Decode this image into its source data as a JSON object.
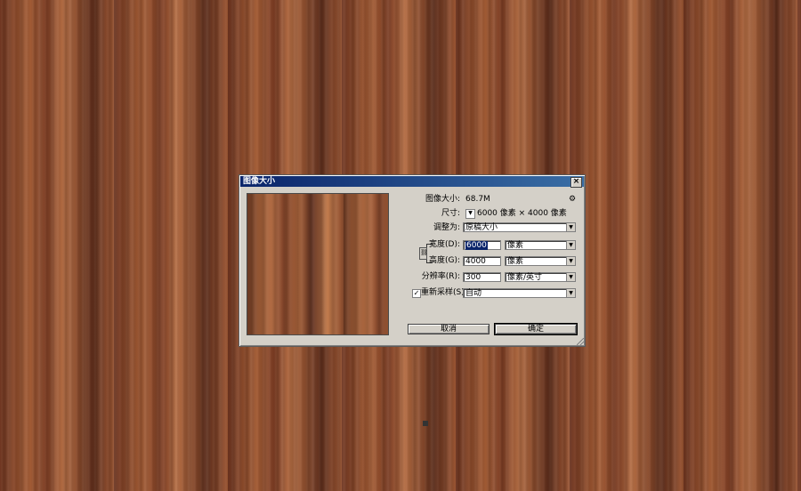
{
  "dialog": {
    "title": "图像大小",
    "close_label": "×",
    "image_size_label": "图像大小:",
    "image_size_value": "68.7M",
    "dimensions_label": "尺寸:",
    "dimensions_value": "6000 像素  ×  4000 像素",
    "fit_to_label": "调整为:",
    "fit_to_value": "原稿大小",
    "width_label": "宽度(D):",
    "width_value": "6000",
    "width_unit": "像素",
    "height_label": "高度(G):",
    "height_value": "4000",
    "height_unit": "像素",
    "resolution_label": "分辨率(R):",
    "resolution_value": "300",
    "resolution_unit": "像素/英寸",
    "resample_label": "重新采样(S):",
    "resample_checked": true,
    "resample_value": "自动",
    "cancel_label": "取消",
    "ok_label": "确定"
  },
  "icons": {
    "gear": "gear-icon",
    "link": "chain-link-icon",
    "dropdown": "triangle-down-icon",
    "check": "checkmark-icon"
  },
  "colors": {
    "titlebar_start": "#0a246a",
    "titlebar_end": "#3a6ea5",
    "dialog_face": "#d4d0c8",
    "wood_dark": "#6f3520",
    "wood_light": "#b56d43"
  }
}
